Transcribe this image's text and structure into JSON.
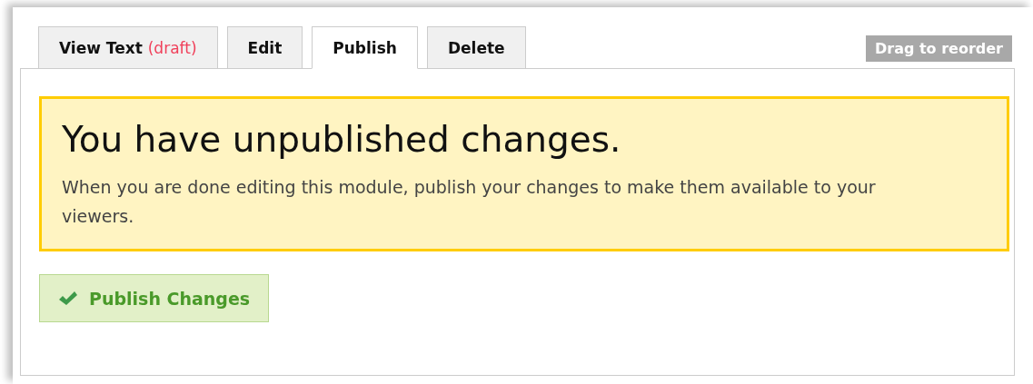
{
  "tabs": [
    {
      "label": "View Text",
      "note": "(draft)",
      "selected": false
    },
    {
      "label": "Edit",
      "selected": false
    },
    {
      "label": "Publish",
      "selected": true
    },
    {
      "label": "Delete",
      "selected": false
    }
  ],
  "reorder_button": {
    "label": "Drag to reorder",
    "disabled": true
  },
  "notice": {
    "title": "You have unpublished changes.",
    "message": "When you are done editing this module, publish your changes to make them available to your viewers."
  },
  "publish_button": {
    "label": "Publish Changes"
  }
}
